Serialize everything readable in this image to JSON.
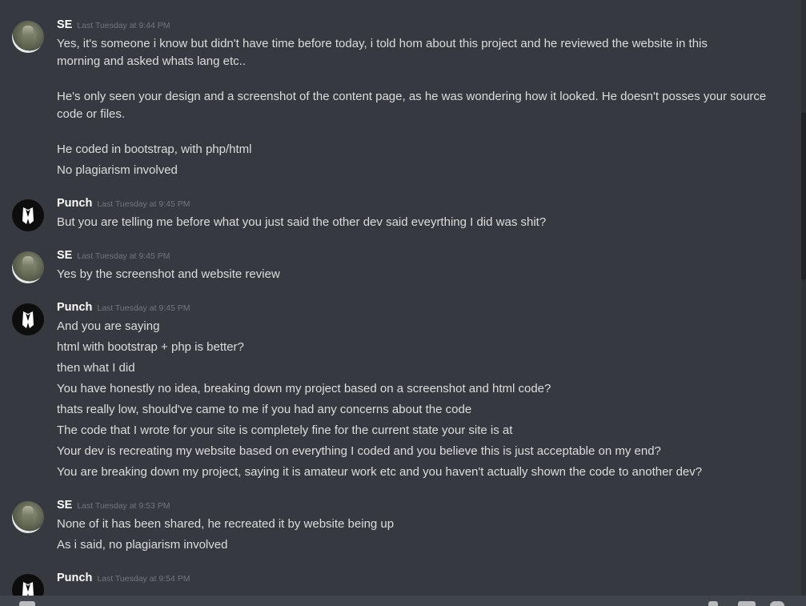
{
  "messages": [
    {
      "author": "SE",
      "timestamp": "Last Tuesday at 9:44 PM",
      "avatar_icon": "camo-person-avatar",
      "lines": [
        "Yes, it's someone i know but didn't have time before today, i told hom about this project and he reviewed the website in this",
        "morning and asked whats lang etc..",
        "He's only seen your design and a screenshot of the content page, as he was wondering how it looked. He doesn't posses your source",
        "code or files.",
        "He coded in bootstrap, with php/html",
        "No plagiarism involved"
      ]
    },
    {
      "author": "Punch",
      "timestamp": "Last Tuesday at 9:45 PM",
      "avatar_icon": "suit-logo-avatar",
      "lines": [
        "But you are telling me before what you just said the other dev said eveyrthing I did was shit?"
      ]
    },
    {
      "author": "SE",
      "timestamp": "Last Tuesday at 9:45 PM",
      "avatar_icon": "camo-person-avatar",
      "lines": [
        "Yes by the screenshot and website review"
      ]
    },
    {
      "author": "Punch",
      "timestamp": "Last Tuesday at 9:45 PM",
      "avatar_icon": "suit-logo-avatar",
      "lines": [
        "And you are saying",
        "html with bootstrap + php is better?",
        "then what I did",
        "You have honestly no idea, breaking down my project based on a screenshot and html code?",
        "thats really low, should've came to me if you had any concerns about the code",
        "The code that I wrote for your site is completely fine for the current state your site is at",
        "Your dev is recreating my website based on everything I coded and you believe this is just acceptable on my end?",
        "You are breaking down my project, saying it is amateur work etc and you haven't actually shown the code to another dev?"
      ]
    },
    {
      "author": "SE",
      "timestamp": "Last Tuesday at 9:53 PM",
      "avatar_icon": "camo-person-avatar",
      "lines": [
        "None of it has been shared, he recreated it by website being up",
        "As i said, no plagiarism involved"
      ]
    },
    {
      "author": "Punch",
      "timestamp": "Last Tuesday at 9:54 PM",
      "avatar_icon": "suit-logo-avatar",
      "lines": []
    }
  ],
  "colors": {
    "background": "#36393f",
    "username": "#ffffff",
    "timestamp": "#72767d",
    "text": "#dcddde",
    "composer": "#40444b"
  }
}
